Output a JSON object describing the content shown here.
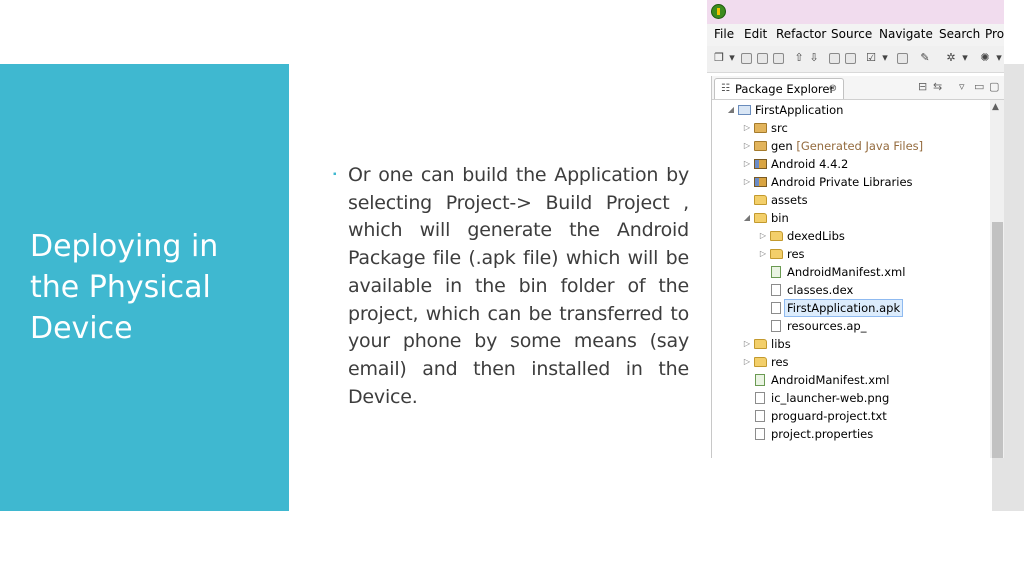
{
  "slide": {
    "title_lines": [
      "Deploying in",
      "the Physical",
      "Device"
    ],
    "bullet": "Or one can build the Application by selecting Project-> Build Project , which will generate the Android Package file (.apk file) which will be available in the bin folder of the project, which can be transferred to your phone by some means (say email) and then installed in the Device.",
    "colors": {
      "accent": "#3fb8d0",
      "text": "#3d3d3d"
    }
  },
  "eclipse": {
    "menu": [
      "File",
      "Edit",
      "Refactor",
      "Source",
      "Navigate",
      "Search",
      "Pro"
    ],
    "view_tab": "Package Explorer",
    "tab_close": "⊗",
    "tree": [
      {
        "label": "FirstApplication",
        "icon": "project-icon",
        "twisty": "◢"
      },
      {
        "label": "src",
        "icon": "package-folder-icon",
        "twisty": "▷"
      },
      {
        "label": "gen",
        "decoration": "[Generated Java Files]",
        "icon": "package-folder-icon",
        "twisty": "▷"
      },
      {
        "label": "Android 4.4.2",
        "icon": "library-icon",
        "twisty": "▷"
      },
      {
        "label": "Android Private Libraries",
        "icon": "library-icon",
        "twisty": "▷"
      },
      {
        "label": "assets",
        "icon": "folder-icon"
      },
      {
        "label": "bin",
        "icon": "folder-icon",
        "twisty": "◢"
      },
      {
        "label": "dexedLibs",
        "icon": "folder-icon",
        "twisty": "▷"
      },
      {
        "label": "res",
        "icon": "folder-icon",
        "twisty": "▷"
      },
      {
        "label": "AndroidManifest.xml",
        "icon": "xml-file-icon"
      },
      {
        "label": "classes.dex",
        "icon": "file-icon"
      },
      {
        "label": "FirstApplication.apk",
        "icon": "file-icon",
        "selected": true
      },
      {
        "label": "resources.ap_",
        "icon": "file-icon"
      },
      {
        "label": "libs",
        "icon": "folder-icon",
        "twisty": "▷"
      },
      {
        "label": "res",
        "icon": "folder-icon",
        "twisty": "▷"
      },
      {
        "label": "AndroidManifest.xml",
        "icon": "xml-file-icon"
      },
      {
        "label": "ic_launcher-web.png",
        "icon": "file-icon"
      },
      {
        "label": "proguard-project.txt",
        "icon": "file-icon"
      },
      {
        "label": "project.properties",
        "icon": "file-icon"
      }
    ]
  }
}
